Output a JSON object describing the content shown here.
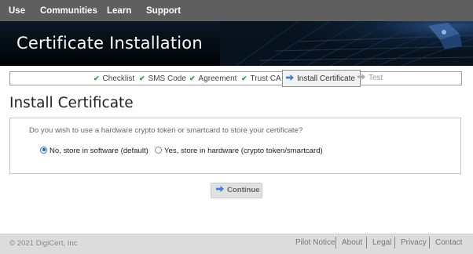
{
  "topnav": {
    "items": [
      "Use",
      "Communities",
      "Learn",
      "Support"
    ]
  },
  "banner": {
    "title": "Certificate Installation"
  },
  "steps": [
    {
      "label": "Checklist",
      "status": "done"
    },
    {
      "label": "SMS Code",
      "status": "done"
    },
    {
      "label": "Agreement",
      "status": "done"
    },
    {
      "label": "Trust CA",
      "status": "done"
    },
    {
      "label": "Install Certificate",
      "status": "current"
    },
    {
      "label": "Test",
      "status": "upcoming"
    }
  ],
  "page": {
    "heading": "Install Certificate"
  },
  "panel": {
    "question": "Do you wish to use a hardware crypto token or smartcard to store your certificate?",
    "options": [
      {
        "label": "No, store in software (default)",
        "selected": true
      },
      {
        "label": "Yes, store in hardware (crypto token/smartcard)",
        "selected": false
      }
    ]
  },
  "actions": {
    "continue_label": "Continue"
  },
  "footer": {
    "copyright": "© 2021 DigiCert, Inc",
    "links": [
      "Pilot Notice",
      "About",
      "Legal",
      "Privacy",
      "Contact"
    ]
  },
  "colors": {
    "nav": "#5f5f5f",
    "banner": "#08131f",
    "check": "#2f9a33",
    "arrow": "#3d7fd6",
    "footer": "#dcdcdc"
  },
  "icons": {
    "done": "check-icon",
    "current": "arrow-right-icon",
    "upcoming": "arrow-right-icon"
  }
}
